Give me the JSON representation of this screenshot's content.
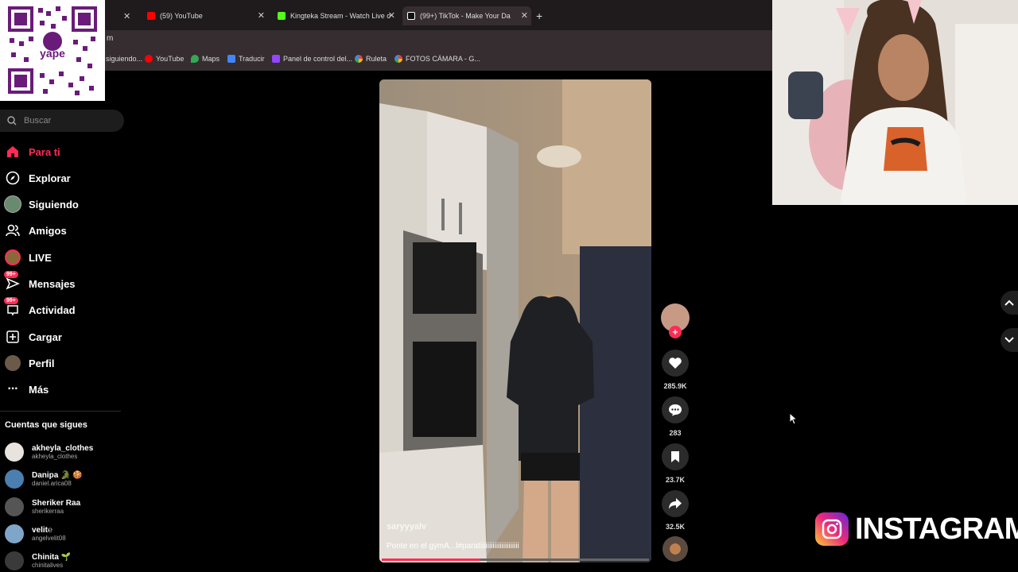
{
  "browser": {
    "tabs": [
      {
        "label": "(59) YouTube",
        "color": "#ff0000"
      },
      {
        "label": "Kingteka Stream - Watch Live o",
        "color": "#53fc18"
      },
      {
        "label": "(99+) TikTok - Make Your Da",
        "color": "#ffffff"
      }
    ],
    "new_tab": "+",
    "address_fragment": "m",
    "bookmarks": [
      {
        "label": "siguiendo...",
        "color": "#9146ff"
      },
      {
        "label": "YouTube",
        "color": "#ff0000"
      },
      {
        "label": "Maps",
        "color": "#34a853"
      },
      {
        "label": "Traducir",
        "color": "#4285f4"
      },
      {
        "label": "Panel de control del...",
        "color": "#9146ff"
      },
      {
        "label": "Ruleta",
        "color": "#ea4335"
      },
      {
        "label": "FOTOS CÁMARA - G...",
        "color": "#fbbc04"
      }
    ]
  },
  "search": {
    "placeholder": "Buscar"
  },
  "nav": [
    {
      "label": "Para ti",
      "icon": "home-icon"
    },
    {
      "label": "Explorar",
      "icon": "compass-icon"
    },
    {
      "label": "Siguiendo",
      "icon": "following-icon"
    },
    {
      "label": "Amigos",
      "icon": "friends-icon"
    },
    {
      "label": "LIVE",
      "icon": "live-icon"
    },
    {
      "label": "Mensajes",
      "icon": "messages-icon",
      "badge": "99+"
    },
    {
      "label": "Actividad",
      "icon": "activity-icon",
      "badge": "99+"
    },
    {
      "label": "Cargar",
      "icon": "upload-icon"
    },
    {
      "label": "Perfil",
      "icon": "profile-icon"
    },
    {
      "label": "Más",
      "icon": "more-icon"
    }
  ],
  "following": {
    "title": "Cuentas que sigues",
    "accounts": [
      {
        "name": "akheyla_clothes",
        "handle": "akheyla_clothes",
        "color": "#e8e3de"
      },
      {
        "name": "Danipa 🐊 🍪",
        "handle": "daniel.arica08",
        "color": "#4a7fb0"
      },
      {
        "name": "Sheriker Raa",
        "handle": "sherikerraa",
        "color": "#555555"
      },
      {
        "name": "velit℮",
        "handle": "angelvelit08",
        "color": "#7fa6c9"
      },
      {
        "name": "Chinita 🌱",
        "handle": "chinitalives",
        "color": "#3a3a3a"
      }
    ]
  },
  "video": {
    "author": "saryyyalv",
    "caption": "Ponte en el gymA...l#paratiiiiiiiiiiiiiiiiiiiiii",
    "progress": 0.37
  },
  "actions": {
    "likes": "285.9K",
    "comments": "283",
    "saves": "23.7K",
    "shares": "32.5K"
  },
  "overlay": {
    "instagram": "INSTAGRAM"
  }
}
